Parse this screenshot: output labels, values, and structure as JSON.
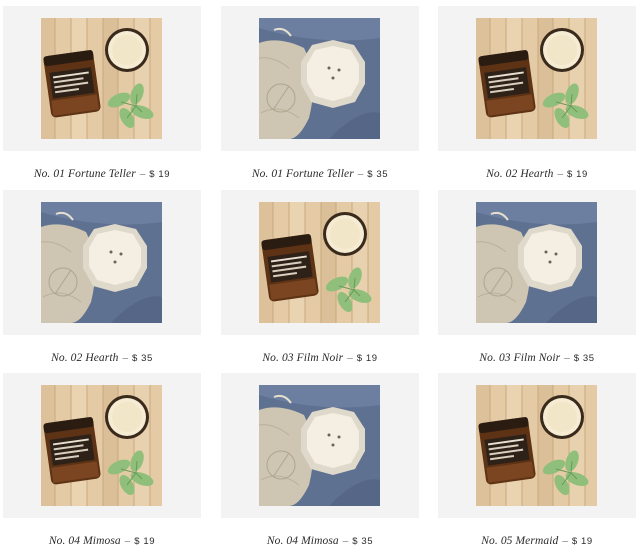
{
  "products": [
    {
      "name": "No. 01 Fortune Teller",
      "price": "$ 19",
      "image": "amber-jar-candle-wood"
    },
    {
      "name": "No. 01 Fortune Teller",
      "price": "$ 35",
      "image": "large-vessel-candle-linen"
    },
    {
      "name": "No. 02 Hearth",
      "price": "$ 19",
      "image": "amber-jar-candle-wood"
    },
    {
      "name": "No. 02 Hearth",
      "price": "$ 35",
      "image": "large-vessel-candle-linen"
    },
    {
      "name": "No. 03 Film Noir",
      "price": "$ 19",
      "image": "amber-jar-candle-wood"
    },
    {
      "name": "No. 03 Film Noir",
      "price": "$ 35",
      "image": "large-vessel-candle-linen"
    },
    {
      "name": "No. 04 Mimosa",
      "price": "$ 19",
      "image": "amber-jar-candle-wood"
    },
    {
      "name": "No. 04 Mimosa",
      "price": "$ 35",
      "image": "large-vessel-candle-linen"
    },
    {
      "name": "No. 05 Mermaid",
      "price": "$ 19",
      "image": "amber-jar-candle-wood"
    }
  ],
  "separator": "–",
  "colors": {
    "card_background": "#f3f3f3",
    "wood": "#e2c9a4",
    "amber_glass": "#6a3a17",
    "linen_blue": "#5f7191",
    "linen_bag": "#cdc5b1",
    "leaf": "#8fbf7a"
  }
}
